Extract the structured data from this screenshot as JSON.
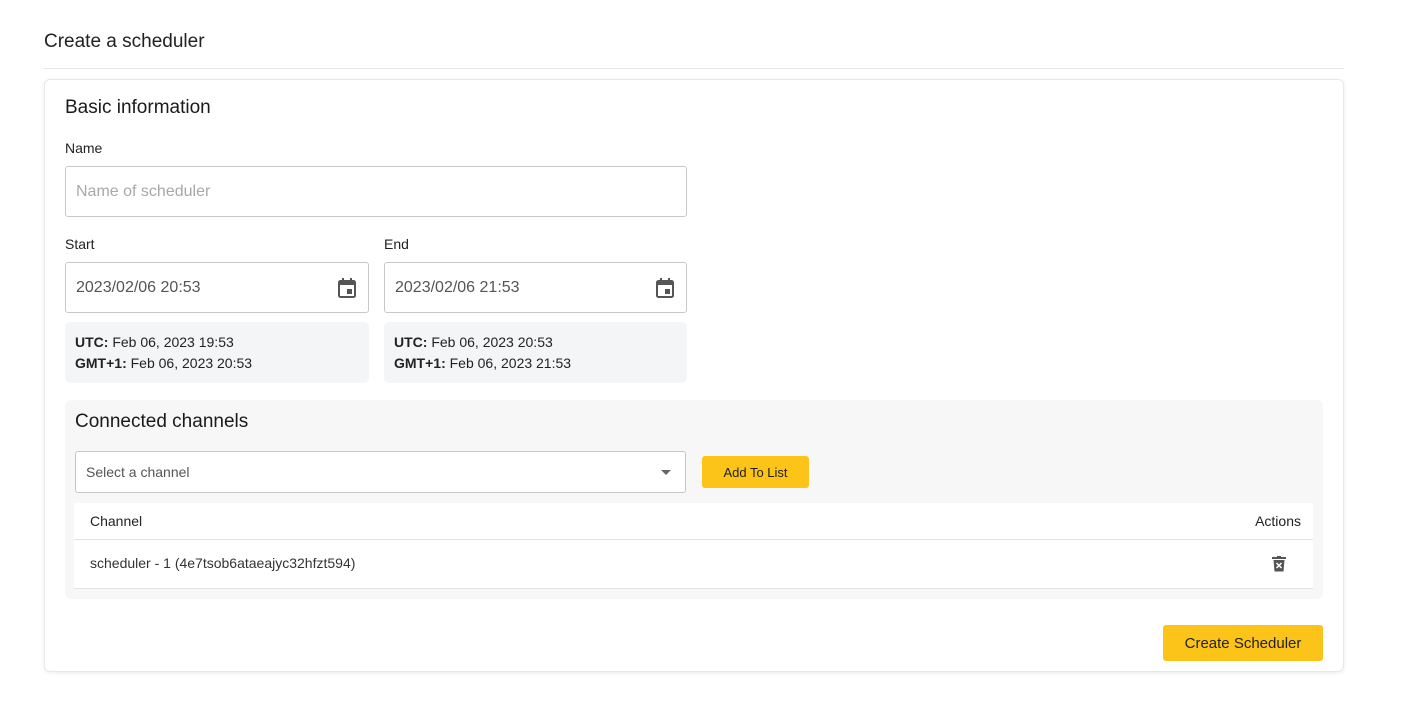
{
  "page": {
    "title": "Create a scheduler"
  },
  "basic": {
    "title": "Basic information",
    "name_label": "Name",
    "name_placeholder": "Name of scheduler",
    "name_value": "",
    "start_label": "Start",
    "end_label": "End",
    "start_value": "2023/02/06 20:53",
    "end_value": "2023/02/06 21:53",
    "start_tz": {
      "utc_label": "UTC:",
      "utc_value": "Feb 06, 2023 19:53",
      "gmt_label": "GMT+1:",
      "gmt_value": "Feb 06, 2023 20:53"
    },
    "end_tz": {
      "utc_label": "UTC:",
      "utc_value": "Feb 06, 2023 20:53",
      "gmt_label": "GMT+1:",
      "gmt_value": "Feb 06, 2023 21:53"
    }
  },
  "channels": {
    "title": "Connected channels",
    "select_placeholder": "Select a channel",
    "add_button": "Add To List",
    "columns": {
      "channel": "Channel",
      "actions": "Actions"
    },
    "rows": [
      {
        "channel": "scheduler - 1 (4e7tsob6ataeajyc32hfzt594)",
        "action_icon": "delete-icon"
      }
    ]
  },
  "actions": {
    "create_button": "Create Scheduler"
  },
  "colors": {
    "accent": "#fcc419"
  }
}
